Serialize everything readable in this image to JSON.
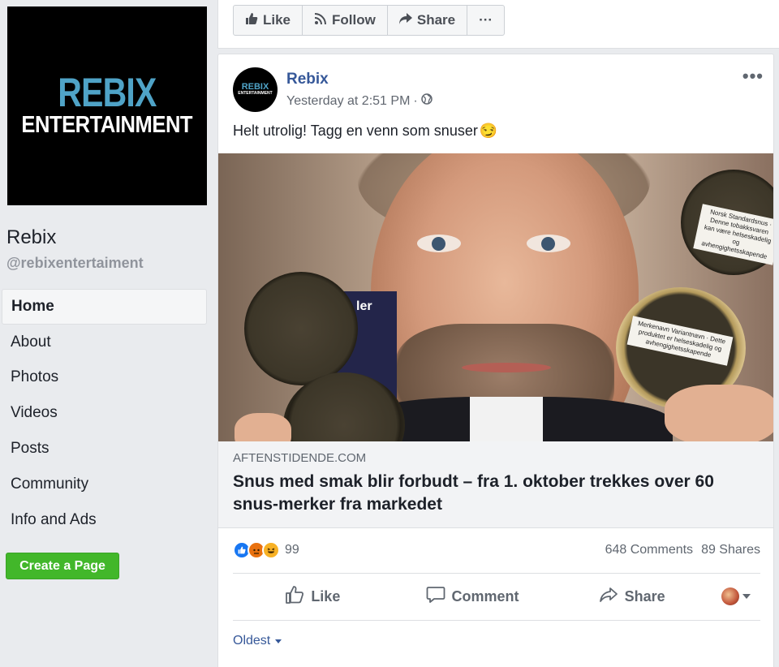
{
  "page": {
    "logo_line1": "REBIX",
    "logo_line2": "ENTERTAINMENT",
    "name": "Rebix",
    "handle": "@rebixentertaiment"
  },
  "nav": {
    "items": [
      {
        "label": "Home",
        "active": true
      },
      {
        "label": "About"
      },
      {
        "label": "Photos"
      },
      {
        "label": "Videos"
      },
      {
        "label": "Posts"
      },
      {
        "label": "Community"
      },
      {
        "label": "Info and Ads"
      }
    ]
  },
  "create_page_label": "Create a Page",
  "topbar": {
    "like_label": "Like",
    "follow_label": "Follow",
    "share_label": "Share",
    "more_label": "···"
  },
  "post": {
    "avatar_line1": "REBIX",
    "avatar_line2": "ENTERTAINMENT",
    "author": "Rebix",
    "time": "Yesterday at 2:51 PM",
    "meta_sep": "·",
    "more_label": "•••",
    "text": "Helt utrolig! Tagg en venn som snuser",
    "emoji": "😏",
    "image_tin_labels": {
      "top_right": "Norsk Standardsnus · Denne tobakksvaren kan være helseskadelig og avhengighetsskapende",
      "right": "Merkenavn Variantnavn · Dette produktet er helseskadelig og avhengighetsskapende",
      "small_text": "ler"
    },
    "link": {
      "domain": "AFTENSTIDENDE.COM",
      "title": "Snus med smak blir forbudt – fra 1. oktober trekkes over 60 snus-merker fra markedet"
    },
    "reaction_count": "99",
    "comments_count": "648 Comments",
    "shares_count": "89 Shares",
    "actions": {
      "like": "Like",
      "comment": "Comment",
      "share": "Share"
    },
    "sort_label": "Oldest"
  },
  "colors": {
    "brand_blue": "#365899",
    "create_green": "#42b72a",
    "logo_teal": "#4fa3c7",
    "background": "#e9ebee"
  },
  "icons": [
    "thumbs-up-icon",
    "rss-follow-icon",
    "share-arrow-icon",
    "more-dots-icon",
    "globe-icon",
    "comment-icon",
    "caret-down-icon"
  ]
}
